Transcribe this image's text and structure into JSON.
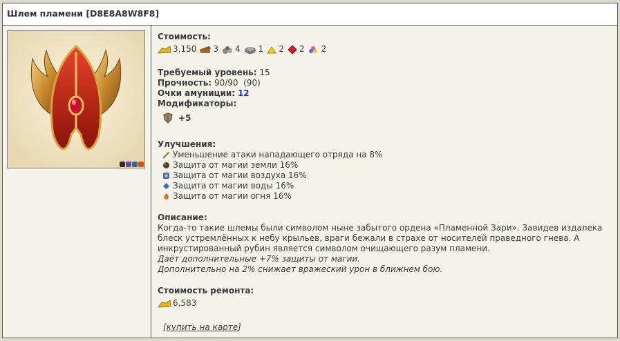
{
  "header": {
    "title": "Шлем пламени [D8E8A8W8F8]"
  },
  "cost": {
    "label": "Стоимость:",
    "items": [
      {
        "icon": "gold-icon",
        "value": "3,150"
      },
      {
        "icon": "wood-icon",
        "value": "3"
      },
      {
        "icon": "ore-icon",
        "value": "4"
      },
      {
        "icon": "mercury-icon",
        "value": "1"
      },
      {
        "icon": "sulfur-icon",
        "value": "2"
      },
      {
        "icon": "crystal-icon",
        "value": "2"
      },
      {
        "icon": "gems-icon",
        "value": "2"
      }
    ]
  },
  "stats": {
    "level_label": "Требуемый уровень:",
    "level_value": "15",
    "durability_label": "Прочность:",
    "durability_value": "90/90  (90)",
    "ammo_label": "Очки амуниции:",
    "ammo_value": "12",
    "modifiers_label": "Модификаторы:",
    "modifier_value": "+5"
  },
  "upgrades": {
    "label": "Улучшения:",
    "items": [
      {
        "icon": "attack-reduction-icon",
        "text": "Уменьшение атаки нападающего отряда на 8%"
      },
      {
        "icon": "earth-icon",
        "text": "Защита от магии земли 16%"
      },
      {
        "icon": "air-icon",
        "text": "Защита от магии воздуха 16%"
      },
      {
        "icon": "water-icon",
        "text": "Защита от магии воды 16%"
      },
      {
        "icon": "fire-icon",
        "text": "Защита от магии огня 16%"
      }
    ]
  },
  "description": {
    "label": "Описание:",
    "text": "Когда-то такие шлемы были символом ныне забытого ордена «Пламенной Зари». Завидев издалека блеск устремлённых к небу крыльев, враги бежали в страхе от носителей праведного гнева. А инкрустированный рубин является символом очищающего разум пламени.",
    "bonus1": "Даёт дополнительные +7% защиты от магии.",
    "bonus2": "Дополнительно на 2% снижает вражеский урон в ближнем бою."
  },
  "repair": {
    "label": "Стоимость ремонта:",
    "value": "6,583"
  },
  "buy": {
    "open": "[",
    "link": "купить на карте",
    "close": "]"
  },
  "colors": {
    "ammo": "#1a2dd1",
    "border": "#5a5a5a",
    "panel": "#f5f3ea"
  }
}
